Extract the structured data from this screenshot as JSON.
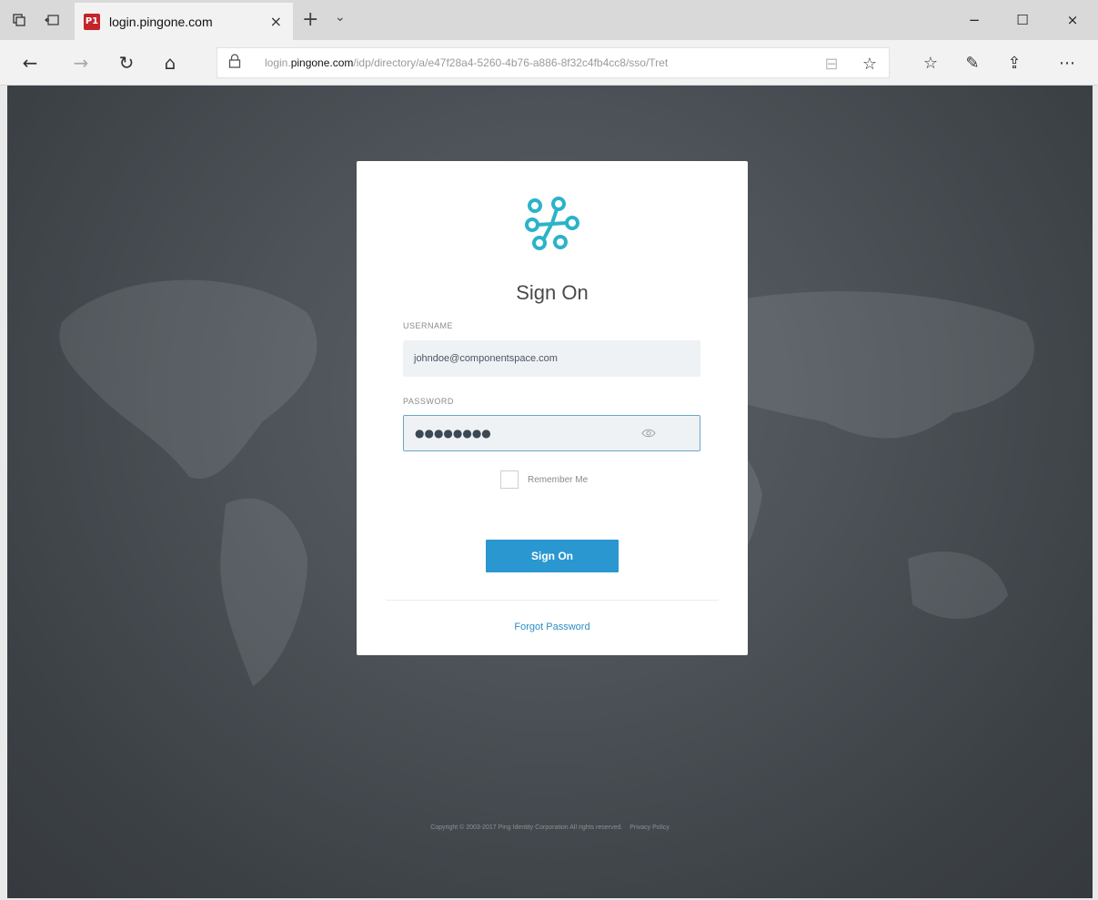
{
  "browser": {
    "tab": {
      "favicon_text": "P1",
      "title": "login.pingone.com",
      "close_glyph": "×"
    },
    "new_tab_glyph": "+",
    "tab_list_glyph": "⌄",
    "window": {
      "minimize_glyph": "−",
      "maximize_glyph": "☐",
      "close_glyph": "×"
    },
    "nav": {
      "back_glyph": "←",
      "forward_glyph": "→",
      "refresh_glyph": "↻",
      "home_glyph": "⌂"
    },
    "address": {
      "prefix": "login.",
      "host": "pingone.com",
      "path": "/idp/directory/a/e47f28a4-5260-4b76-a886-8f32c4fb4cc8/sso/Tret"
    },
    "icons": {
      "reading_view_glyph": "⊟",
      "favorite_glyph": "☆",
      "favorites_hub_glyph": "☆",
      "notes_glyph": "✎",
      "share_glyph": "⇪",
      "more_glyph": "⋯"
    }
  },
  "login": {
    "title": "Sign On",
    "username_label": "USERNAME",
    "username_value": "johndoe@componentspace.com",
    "password_label": "PASSWORD",
    "password_masked": "●●●●●●●●",
    "remember_label": "Remember Me",
    "remember_checked": false,
    "submit_label": "Sign On",
    "forgot_label": "Forgot Password"
  },
  "footer": {
    "copyright": "Copyright © 2003-2017 Ping Identity Corporation All rights reserved.",
    "privacy": "Privacy Policy"
  },
  "colors": {
    "accent": "#2a97d1",
    "logo": "#2bb3c9",
    "background": "#4c5257"
  }
}
